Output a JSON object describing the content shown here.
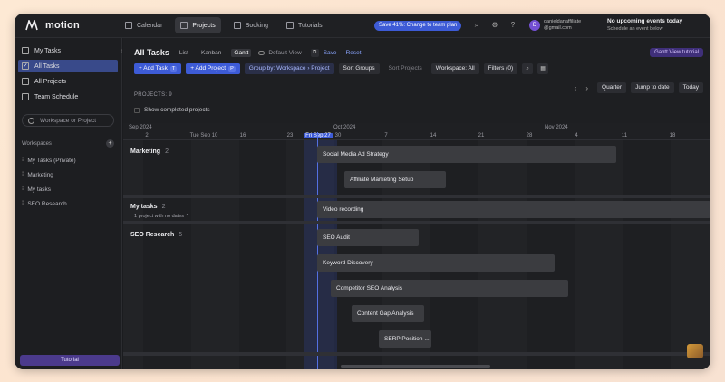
{
  "app": {
    "name": "motion"
  },
  "nav": {
    "tabs": [
      {
        "label": "Calendar",
        "icon": "calendar-icon"
      },
      {
        "label": "Projects",
        "icon": "projects-icon",
        "active": true
      },
      {
        "label": "Booking",
        "icon": "booking-icon"
      },
      {
        "label": "Tutorials",
        "icon": "tutorials-icon"
      }
    ],
    "promo": "Save 41%: Change to team plan",
    "user": {
      "initial": "D",
      "name": "danieldanaffiliate",
      "email": "@gmail.com"
    },
    "events": {
      "title": "No upcoming events today",
      "subtitle": "Schedule an event below"
    }
  },
  "sidebar": {
    "items": [
      {
        "label": "My Tasks",
        "active": false
      },
      {
        "label": "All Tasks",
        "active": true
      },
      {
        "label": "All Projects",
        "active": false
      },
      {
        "label": "Team Schedule",
        "active": false
      }
    ],
    "search_placeholder": "Workspace or Project",
    "workspaces_title": "Workspaces",
    "workspaces": [
      "My Tasks (Private)",
      "Marketing",
      "My tasks",
      "SEO Research"
    ],
    "tutorial": "Tutorial"
  },
  "main": {
    "title": "All Tasks",
    "views": [
      "List",
      "Kanban",
      "Gantt"
    ],
    "active_view": "Gantt",
    "default_view": "Default View",
    "save": "Save",
    "reset": "Reset",
    "gantt_tutorial": "Gantt View tutorial",
    "toolbar": {
      "add_task": "+ Add Task",
      "add_task_kbd": "T",
      "add_project": "+ Add Project",
      "add_project_kbd": "P",
      "group_by": "Group by: Workspace › Project",
      "sort_groups": "Sort Groups",
      "sort_projects": "Sort Projects",
      "workspace": "Workspace: All",
      "filters": "Filters (0)"
    },
    "right_controls": {
      "range": "Quarter",
      "jump": "Jump to date",
      "today": "Today"
    },
    "projects_count": "PROJECTS: 9",
    "show_completed": "Show completed projects"
  },
  "timeline": {
    "months": [
      "Sep 2024",
      "Oct 2024",
      "Nov 2024"
    ],
    "days": [
      "2",
      "Tue Sep 10",
      "16",
      "23",
      "Fri Sep 27",
      "30",
      "7",
      "14",
      "21",
      "28",
      "4",
      "11",
      "18"
    ],
    "today_label": "Fri Sep 27",
    "groups": [
      {
        "name": "Marketing",
        "count": "2",
        "bars": [
          "Social Media Ad Strategy",
          "Affiliate Marketing Setup"
        ]
      },
      {
        "name": "My tasks",
        "count": "2",
        "sub": "1 project with no dates",
        "bars": [
          "Video recording"
        ]
      },
      {
        "name": "SEO Research",
        "count": "5",
        "bars": [
          "SEO Audit",
          "Keyword Discovery",
          "Competitor SEO Analysis",
          "Content Gap Analysis",
          "SERP Position ..."
        ]
      }
    ]
  }
}
